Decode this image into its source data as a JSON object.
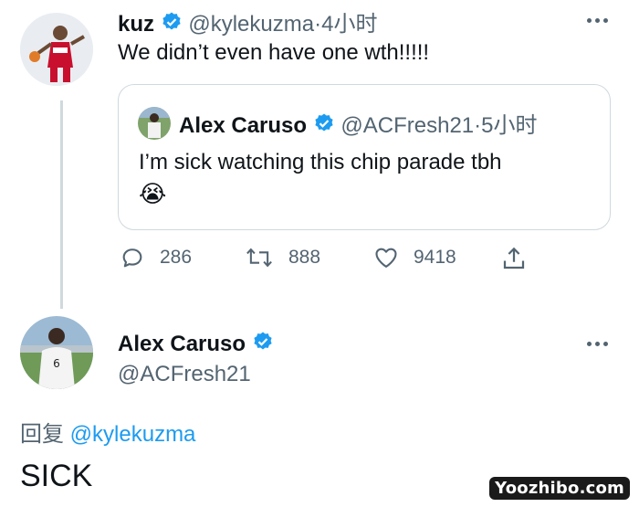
{
  "colors": {
    "accent": "#1d9bf0",
    "muted": "#536471",
    "text": "#0f1419",
    "border": "#cfd9de"
  },
  "tweet1": {
    "name": "kuz",
    "handle": "@kylekuzma",
    "separator": "·",
    "time": "4小时",
    "text": "We didn’t even have one wth!!!!!",
    "quote": {
      "name": "Alex Caruso",
      "handle": "@ACFresh21",
      "separator": "·",
      "time": "5小时",
      "text": "I’m sick watching this chip parade tbh",
      "emoji": "😭"
    },
    "actions": {
      "replies": "286",
      "retweets": "888",
      "likes": "9418"
    }
  },
  "tweet2": {
    "name": "Alex Caruso",
    "handle": "@ACFresh21",
    "reply_prefix": "回复",
    "reply_to": "@kylekuzma",
    "text": "SICK"
  },
  "watermark": "Yoozhibo.com"
}
